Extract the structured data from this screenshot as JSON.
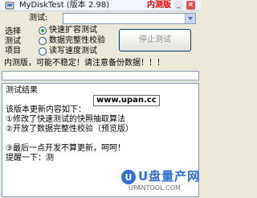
{
  "window": {
    "title": "MyDiskTest (版本 2.98)",
    "badge": "内测版"
  },
  "drive": {
    "label": "测试:",
    "value": ""
  },
  "test_mode": {
    "group_label_line1": "选择",
    "group_label_line2": "测试",
    "group_label_line3": "项目",
    "options": [
      {
        "label": "快速扩容测试",
        "checked": true
      },
      {
        "label": "数据完整性校验",
        "checked": false
      },
      {
        "label": "读写速度测试",
        "checked": false
      }
    ]
  },
  "controls": {
    "stop_button_label": "停止测试"
  },
  "warning_text": "内测版，可能不稳定！请注意备份数据！！！",
  "log": {
    "lines": [
      "测试结果",
      "",
      "该版本更新内容如下：",
      "①修改了快速测试的快照抽取算法",
      "②开放了数据完整性校验（预览版）",
      "",
      "③最后一点开发不算更新，呵呵！",
      "提醒一下：测"
    ]
  },
  "watermarks": {
    "site_url": "www.upan.cc",
    "logo_text": "U盘量产网",
    "logo_url": "UPANTOOL.COM"
  },
  "colors": {
    "badge": "#e00000",
    "logo": "#2e6fd0",
    "radio_dot": "#21a121"
  }
}
